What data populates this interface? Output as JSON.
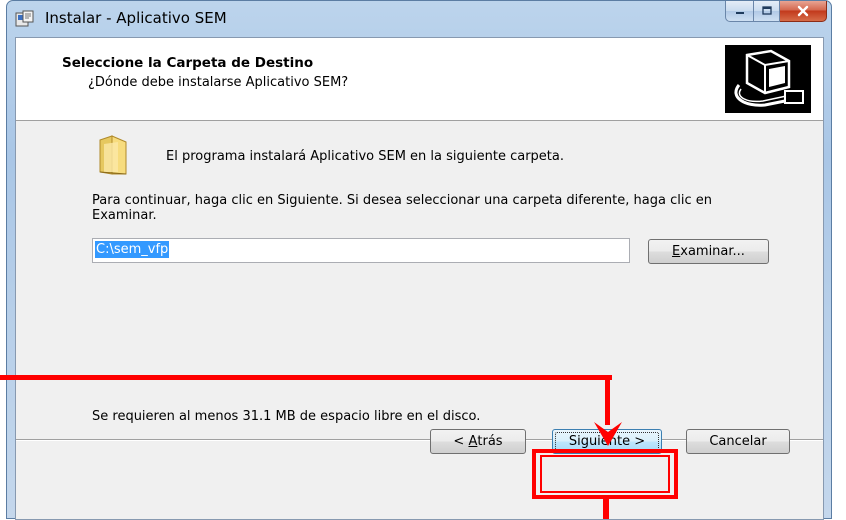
{
  "window": {
    "title": "Instalar - Aplicativo SEM",
    "controls": {
      "minimize_icon": "minimize-icon",
      "maximize_icon": "maximize-icon",
      "close_icon": "close-icon"
    }
  },
  "header": {
    "title": "Seleccione la Carpeta de Destino",
    "subtitle": "¿Dónde debe instalarse Aplicativo SEM?",
    "image_icon": "computer-install-icon"
  },
  "body": {
    "folder_icon": "folder-icon",
    "folder_message": "El programa instalará Aplicativo SEM en la siguiente carpeta.",
    "continue_text": "Para continuar, haga clic en Siguiente. Si desea seleccionar una carpeta diferente, haga clic en Examinar.",
    "path_value": "C:\\sem_vfp",
    "browse_label_first": "E",
    "browse_label_rest": "xaminar...",
    "space_required": "Se requieren al menos 31.1 MB de espacio libre en el disco."
  },
  "footer": {
    "back_label_pre": "< ",
    "back_label_accel": "A",
    "back_label_post": "trás",
    "next_label": "Siguiente >",
    "cancel_label": "Cancelar"
  },
  "annotation": {
    "color": "#ff0000"
  }
}
